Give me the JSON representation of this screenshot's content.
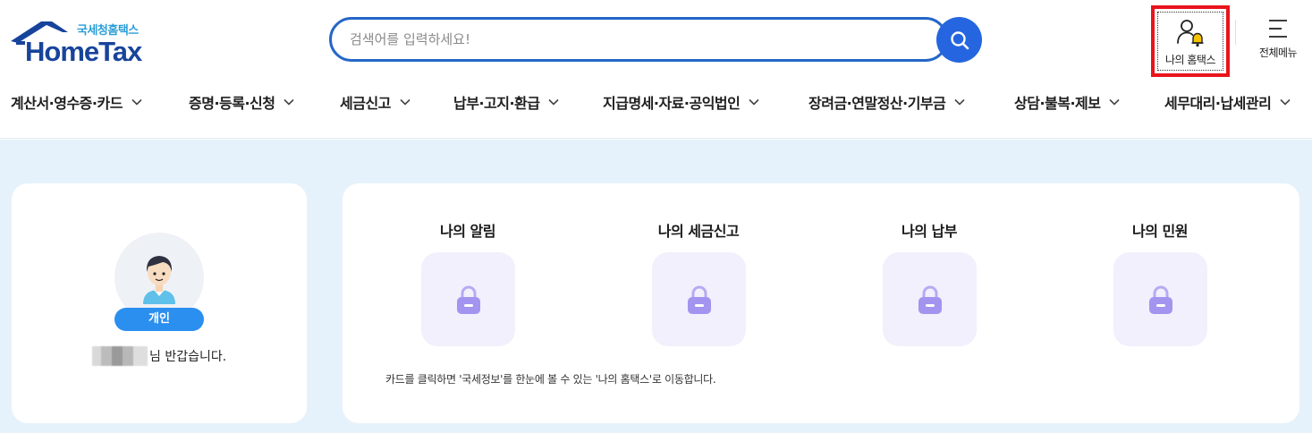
{
  "header": {
    "logo_sub": "국세청홈택스",
    "logo_main": "HomeTax",
    "search_placeholder": "검색어를 입력하세요!",
    "my_hometax_label": "나의 홈택스",
    "all_menu_label": "전체메뉴"
  },
  "nav": {
    "items": [
      {
        "label": "계산서·영수증·카드"
      },
      {
        "label": "증명·등록·신청"
      },
      {
        "label": "세금신고"
      },
      {
        "label": "납부·고지·환급"
      },
      {
        "label": "지급명세·자료·공익법인"
      },
      {
        "label": "장려금·연말정산·기부금"
      },
      {
        "label": "상담·불복·제보"
      },
      {
        "label": "세무대리·납세관리"
      }
    ]
  },
  "profile": {
    "badge": "개인",
    "greeting": "님 반갑습니다."
  },
  "cards": {
    "items": [
      {
        "title": "나의 알림",
        "icon": "lock-icon"
      },
      {
        "title": "나의 세금신고",
        "icon": "lock-icon"
      },
      {
        "title": "나의 납부",
        "icon": "lock-icon"
      },
      {
        "title": "나의 민원",
        "icon": "lock-icon"
      }
    ],
    "note": "카드를 클릭하면 '국세정보'를 한눈에 볼 수 있는 '나의 홈택스'로 이동합니다."
  },
  "colors": {
    "brand_blue": "#17449b",
    "search_border": "#2566c8",
    "highlight_red": "#e8141c",
    "badge_blue": "#2b8ff0",
    "lock_purple": "#a89af0",
    "main_bg": "#e6f2fb"
  }
}
